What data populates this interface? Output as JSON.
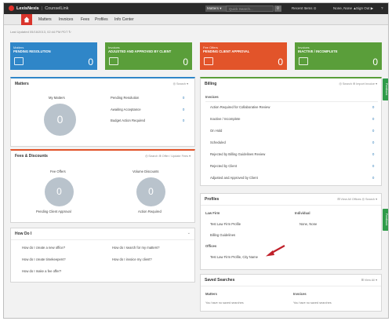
{
  "app": {
    "brand": "LexisNexis",
    "product": "CounselLink"
  },
  "topbar": {
    "matters_select": "Matters ▾",
    "search_placeholder": "Quick Search...",
    "recent_items": "Recent Items ⊙",
    "user": "None, None ▲",
    "sign_out": "Sign Out ▶",
    "help": "?"
  },
  "nav": {
    "items": [
      "Matters",
      "Invoices",
      "Fees",
      "Profiles",
      "Info Center"
    ]
  },
  "last_updated": "Last Updated 05/16/2013, 02:44 PM PDT ↻",
  "tiles": [
    {
      "category": "Matters",
      "title": "PENDING RESOLUTION",
      "count": "0",
      "color": "#2f86c8"
    },
    {
      "category": "Invoices",
      "title": "ADJUSTED AND APPROVED BY CLIENT",
      "count": "0",
      "color": "#5a9e3a"
    },
    {
      "category": "Fee Offers",
      "title": "PENDING CLIENT APPROVAL",
      "count": "0",
      "color": "#e2542a"
    },
    {
      "category": "Invoices",
      "title": "INACTIVE / INCOMPLETE",
      "count": "0",
      "color": "#5a9e3a"
    }
  ],
  "matters": {
    "title": "Matters",
    "tools": "◎ Search ▾",
    "circle_label": "My Matters",
    "circle_value": "0",
    "rows": [
      {
        "label": "Pending Resolution",
        "count": "0"
      },
      {
        "label": "Awaiting Acceptance",
        "count": "0"
      },
      {
        "label": "Budget Action Required",
        "count": "0"
      }
    ]
  },
  "fees": {
    "title": "Fees & Discounts",
    "tools": "◎ Search  ⊕ Offer / Update Fees  ▾",
    "left_label": "Fee Offers",
    "left_value": "0",
    "left_caption": "Pending Client Approval",
    "right_label": "Volume Discounts",
    "right_value": "0",
    "right_caption": "Action Required"
  },
  "howdoi": {
    "title": "How Do I",
    "links": [
      "How do I create a new office?",
      "How do I search for my matters?",
      "How do I create timekeepers?",
      "How do I invoice my client?",
      "How do I make a fee offer?"
    ]
  },
  "billing": {
    "title": "Billing",
    "tools": "◎ Search  ⊕ Import Invoice  ▾",
    "section": "Invoices",
    "rows": [
      {
        "label": "Action Required for Collaborative Review",
        "count": "0"
      },
      {
        "label": "Inactive / Incomplete",
        "count": "0"
      },
      {
        "label": "On Hold",
        "count": "0"
      },
      {
        "label": "Scheduled",
        "count": "0"
      },
      {
        "label": "Rejected by Billing Guidelines Review",
        "count": "0"
      },
      {
        "label": "Rejected by Client",
        "count": "0"
      },
      {
        "label": "Adjusted and Approved by Client",
        "count": "0"
      }
    ]
  },
  "profiles": {
    "title": "Profiles",
    "tools": "⊞ View All Offices  ◎ Search  ▾",
    "law_firm_header": "Law Firm",
    "individual_header": "Individual",
    "law_firm_links": [
      "Test Law Firm Profile",
      "Billing Guidelines"
    ],
    "individual_value": "None, None",
    "offices_header": "Offices",
    "office_link": "Test Law Firm Profile, City Name"
  },
  "saved": {
    "title": "Saved Searches",
    "tools": "⊞ View All  ▾",
    "matters_header": "Matters",
    "matters_text": "You have no saved searches",
    "invoices_header": "Invoices",
    "invoices_text": "You have no saved searches"
  },
  "feedback": "Feedback",
  "colors": {
    "accent_red": "#d9342b",
    "link_blue": "#2a7ab8",
    "arrow": "#c0202a"
  }
}
